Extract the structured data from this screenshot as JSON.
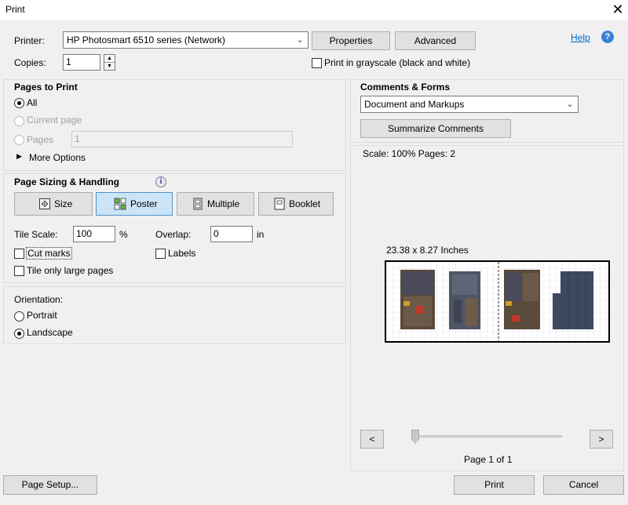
{
  "window": {
    "title": "Print",
    "close_glyph": "✕"
  },
  "printer": {
    "label": "Printer:",
    "value": "HP Photosmart 6510 series (Network)",
    "properties_label": "Properties",
    "advanced_label": "Advanced",
    "help_label": "Help",
    "copies_label": "Copies:",
    "copies_value": "1",
    "grayscale_label": "Print in grayscale (black and white)"
  },
  "pages_to_print": {
    "heading": "Pages to Print",
    "all_label": "All",
    "current_label": "Current page",
    "pages_label": "Pages",
    "pages_value": "1",
    "more_options_label": "More Options"
  },
  "sizing": {
    "heading": "Page Sizing & Handling",
    "buttons": [
      {
        "label": "Size",
        "icon": "size-icon"
      },
      {
        "label": "Poster",
        "icon": "poster-icon"
      },
      {
        "label": "Multiple",
        "icon": "multiple-icon"
      },
      {
        "label": "Booklet",
        "icon": "booklet-icon"
      }
    ],
    "active_button": "Poster",
    "tile_scale_label": "Tile Scale:",
    "tile_scale_value": "100",
    "tile_scale_unit": "%",
    "overlap_label": "Overlap:",
    "overlap_value": "0",
    "overlap_unit": "in",
    "cut_marks_label": "Cut marks",
    "labels_label": "Labels",
    "tile_large_label": "Tile only large pages"
  },
  "orientation": {
    "heading": "Orientation:",
    "portrait_label": "Portrait",
    "landscape_label": "Landscape",
    "selected": "Landscape"
  },
  "comments": {
    "heading": "Comments & Forms",
    "value": "Document and Markups",
    "summarize_label": "Summarize Comments"
  },
  "preview": {
    "scale_text": "Scale: 100% Pages: 2",
    "dimensions": "23.38 x 8.27 Inches",
    "prev_glyph": "<",
    "next_glyph": ">",
    "page_text": "Page 1 of 1"
  },
  "footer": {
    "page_setup_label": "Page Setup...",
    "print_label": "Print",
    "cancel_label": "Cancel"
  },
  "colors": {
    "accent": "#0066cc",
    "active_button_bg": "#cce4f7",
    "dialog_bg": "#f0f0f0"
  }
}
